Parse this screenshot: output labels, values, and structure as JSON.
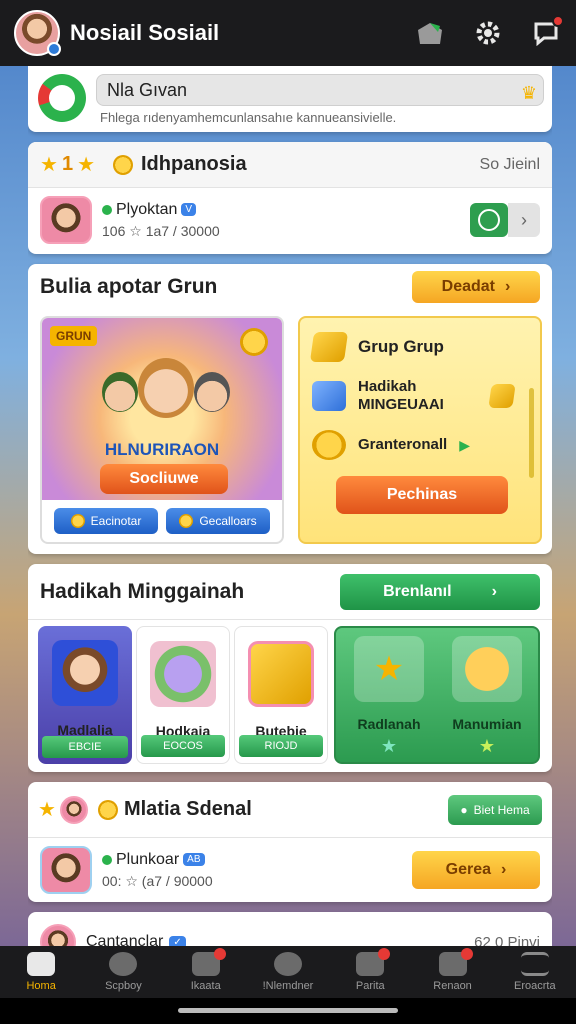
{
  "app": {
    "title": "Nosiail Sosiail"
  },
  "search": {
    "value": "Nla Gıvan",
    "hint": "Fhlega rıdenyamhemcunlansahıe kannueansivielle."
  },
  "group": {
    "count": "1",
    "title": "Idhpanosia",
    "right": "So Jieinl"
  },
  "member1": {
    "name": "Plyoktan",
    "badge": "V",
    "stats": "106 ☆ 1a7 / 30000"
  },
  "promo": {
    "title": "Bulia apotar Grun",
    "button": "Deadat",
    "art_tag": "GRUN",
    "art_brand": "HLNURIRAON",
    "art_button": "Socliuwe",
    "tabs": [
      "Eacinotar",
      "Gecalloars"
    ],
    "right_items": [
      "Grup Grup",
      "Hadikah MINGEUAAI",
      "Granteronall"
    ],
    "right_button": "Pechinas"
  },
  "gifts": {
    "title": "Hadikah Minggainah",
    "button": "Brenlanıl",
    "tiles": [
      {
        "name": "Madlalia",
        "pill": "EBCIE"
      },
      {
        "name": "Hodkaia",
        "pill": "EOCOS"
      },
      {
        "name": "Butebie",
        "pill": "RIOJD"
      }
    ],
    "panel": [
      {
        "name": "Radlanah"
      },
      {
        "name": "Manumian"
      }
    ]
  },
  "members": {
    "title": "Mlatia Sdenal",
    "button": "Biet Hema",
    "member": {
      "name": "Plunkoar",
      "badge": "AB",
      "stats": "00: ☆ (a7 / 90000"
    },
    "action": "Gerea"
  },
  "last": {
    "name": "Cantanclar",
    "right": "62 0 Pinvi"
  },
  "nav": [
    "Homa",
    "Scpboy",
    "Ikaata",
    "!Nlemdner",
    "Parita",
    "Renaon",
    "Eroacrta"
  ],
  "colors": {
    "accent": "#f5b400",
    "green": "#2bb24c",
    "topbar": "#1b1b1d"
  }
}
